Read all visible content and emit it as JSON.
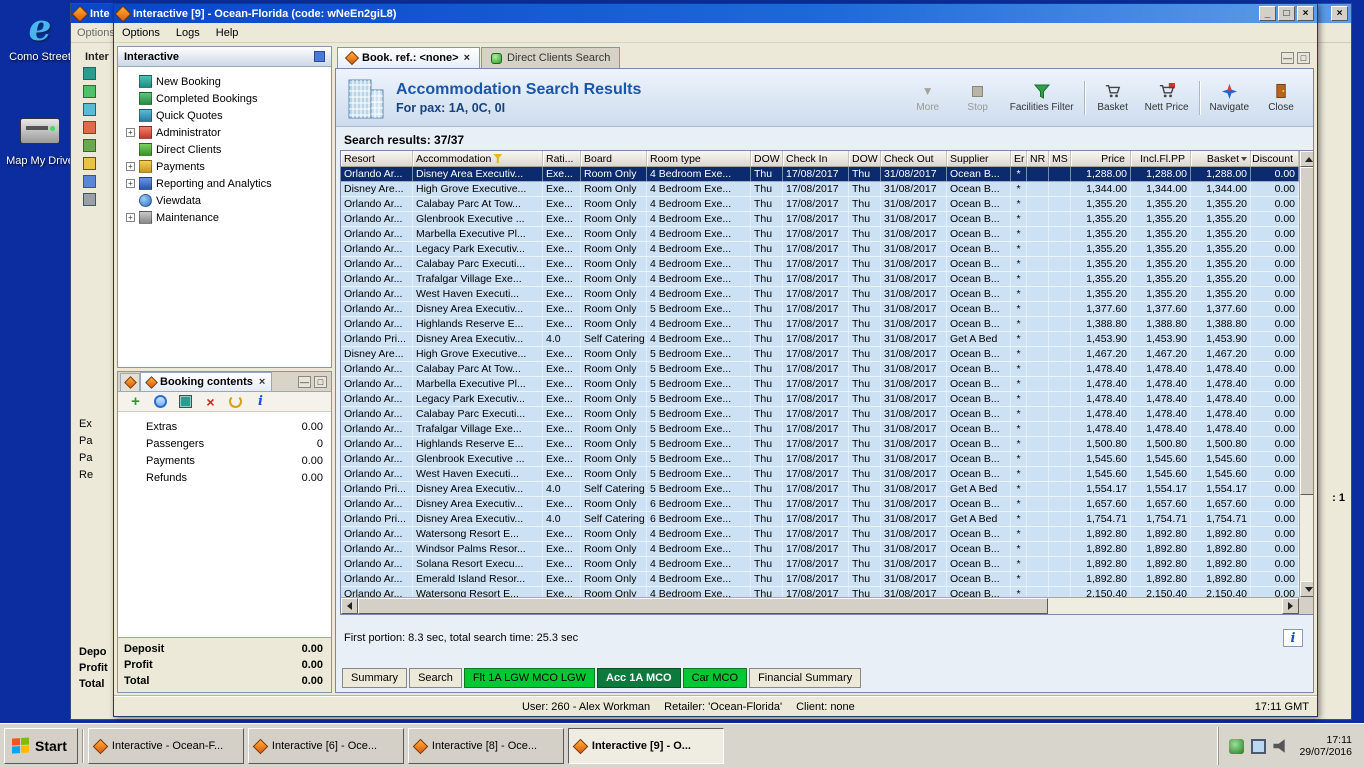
{
  "desktop": {
    "icons": [
      {
        "label": "Como Street"
      },
      {
        "label": "Map My Drive"
      }
    ]
  },
  "bg_window": {
    "title": "Inte",
    "menu": "Options",
    "panel_title": "Inter",
    "row_fragments": [
      "Ex",
      "Pa",
      "Pa",
      "Re"
    ],
    "total_fragments": [
      "Depo",
      "Profit",
      "Total"
    ],
    "right_fragment": ": 1"
  },
  "window": {
    "title": "Interactive [9] - Ocean-Florida (code: wNeEn2giL8)",
    "menu_items": [
      "Options",
      "Logs",
      "Help"
    ]
  },
  "nav_panel": {
    "title": "Interactive",
    "items": [
      {
        "label": "New Booking",
        "expand": "",
        "ic": "icon-booking"
      },
      {
        "label": "Completed Bookings",
        "expand": "",
        "ic": "icon-completed"
      },
      {
        "label": "Quick Quotes",
        "expand": "",
        "ic": "icon-quotes"
      },
      {
        "label": "Administrator",
        "expand": "+",
        "ic": "icon-admin"
      },
      {
        "label": "Direct Clients",
        "expand": "",
        "ic": "icon-clients"
      },
      {
        "label": "Payments",
        "expand": "+",
        "ic": "icon-payments"
      },
      {
        "label": "Reporting and Analytics",
        "expand": "+",
        "ic": "icon-reports"
      },
      {
        "label": "Viewdata",
        "expand": "",
        "ic": "icon-viewdata"
      },
      {
        "label": "Maintenance",
        "expand": "+",
        "ic": "icon-maintenance"
      }
    ]
  },
  "booking_panel": {
    "tab_title": "Booking contents",
    "close_glyph": "×",
    "rows": [
      {
        "label": "Extras",
        "value": "0.00"
      },
      {
        "label": "Passengers",
        "value": "0"
      },
      {
        "label": "Payments",
        "value": "0.00"
      },
      {
        "label": "Refunds",
        "value": "0.00"
      }
    ],
    "totals": [
      {
        "label": "Deposit",
        "value": "0.00"
      },
      {
        "label": "Profit",
        "value": "0.00"
      },
      {
        "label": "Total",
        "value": "0.00"
      }
    ]
  },
  "workspace": {
    "tabs": [
      {
        "label": "Book. ref.: <none>",
        "cls": "active",
        "icon": "orange",
        "close": "×"
      },
      {
        "label": "Direct Clients Search",
        "cls": "",
        "icon": "green",
        "close": ""
      }
    ],
    "header": {
      "title": "Accommodation Search Results",
      "subtitle": "For pax: 1A, 0C, 0I"
    },
    "toolbar": {
      "more": "More",
      "stop": "Stop",
      "facilities": "Facilities Filter",
      "basket": "Basket",
      "nett": "Nett Price",
      "navigate": "Navigate",
      "close": "Close"
    },
    "results_label": "Search results: 37/37",
    "timing": "First portion: 8.3 sec, total search time: 25.3 sec",
    "bottom_tabs": [
      {
        "label": "Summary",
        "cls": ""
      },
      {
        "label": "Search",
        "cls": ""
      },
      {
        "label": "Flt 1A LGW MCO LGW",
        "cls": "green"
      },
      {
        "label": "Acc 1A MCO",
        "cls": "darkgreen"
      },
      {
        "label": "Car MCO",
        "cls": "green"
      },
      {
        "label": "Financial Summary",
        "cls": ""
      }
    ],
    "status": {
      "parts": [
        "User: 260 - Alex Workman",
        "Retailer: 'Ocean-Florida'",
        "Client: none"
      ],
      "time": "17:11 GMT"
    }
  },
  "table": {
    "columns": [
      {
        "label": "Resort"
      },
      {
        "label": "Accommodation",
        "suffix": "filter"
      },
      {
        "label": "Rati..."
      },
      {
        "label": "Board"
      },
      {
        "label": "Room type"
      },
      {
        "label": "DOW"
      },
      {
        "label": "Check In"
      },
      {
        "label": "DOW"
      },
      {
        "label": "Check Out"
      },
      {
        "label": "Supplier"
      },
      {
        "label": "Er"
      },
      {
        "label": "NR"
      },
      {
        "label": "MS"
      },
      {
        "label": "Price",
        "cls": "num"
      },
      {
        "label": "Incl.Fl.PP",
        "cls": "num"
      },
      {
        "label": "Basket",
        "cls": "num",
        "suffix": "sort"
      },
      {
        "label": "Discount",
        "cls": "num"
      }
    ],
    "rows": [
      {
        "sel": "sel",
        "c": [
          "Orlando Ar...",
          "Disney Area Executiv...",
          "Exe...",
          "Room Only",
          "4 Bedroom Exe...",
          "Thu",
          "17/08/2017",
          "Thu",
          "31/08/2017",
          "Ocean B...",
          "*",
          "",
          "",
          "1,288.00",
          "1,288.00",
          "1,288.00",
          "0.00"
        ]
      },
      {
        "sel": "",
        "c": [
          "Disney Are...",
          "High Grove Executive...",
          "Exe...",
          "Room Only",
          "4 Bedroom Exe...",
          "Thu",
          "17/08/2017",
          "Thu",
          "31/08/2017",
          "Ocean B...",
          "*",
          "",
          "",
          "1,344.00",
          "1,344.00",
          "1,344.00",
          "0.00"
        ]
      },
      {
        "sel": "",
        "c": [
          "Orlando Ar...",
          "Calabay Parc At Tow...",
          "Exe...",
          "Room Only",
          "4 Bedroom Exe...",
          "Thu",
          "17/08/2017",
          "Thu",
          "31/08/2017",
          "Ocean B...",
          "*",
          "",
          "",
          "1,355.20",
          "1,355.20",
          "1,355.20",
          "0.00"
        ]
      },
      {
        "sel": "",
        "c": [
          "Orlando Ar...",
          "Glenbrook Executive ...",
          "Exe...",
          "Room Only",
          "4 Bedroom Exe...",
          "Thu",
          "17/08/2017",
          "Thu",
          "31/08/2017",
          "Ocean B...",
          "*",
          "",
          "",
          "1,355.20",
          "1,355.20",
          "1,355.20",
          "0.00"
        ]
      },
      {
        "sel": "",
        "c": [
          "Orlando Ar...",
          "Marbella Executive Pl...",
          "Exe...",
          "Room Only",
          "4 Bedroom Exe...",
          "Thu",
          "17/08/2017",
          "Thu",
          "31/08/2017",
          "Ocean B...",
          "*",
          "",
          "",
          "1,355.20",
          "1,355.20",
          "1,355.20",
          "0.00"
        ]
      },
      {
        "sel": "",
        "c": [
          "Orlando Ar...",
          "Legacy Park Executiv...",
          "Exe...",
          "Room Only",
          "4 Bedroom Exe...",
          "Thu",
          "17/08/2017",
          "Thu",
          "31/08/2017",
          "Ocean B...",
          "*",
          "",
          "",
          "1,355.20",
          "1,355.20",
          "1,355.20",
          "0.00"
        ]
      },
      {
        "sel": "",
        "c": [
          "Orlando Ar...",
          "Calabay Parc Executi...",
          "Exe...",
          "Room Only",
          "4 Bedroom Exe...",
          "Thu",
          "17/08/2017",
          "Thu",
          "31/08/2017",
          "Ocean B...",
          "*",
          "",
          "",
          "1,355.20",
          "1,355.20",
          "1,355.20",
          "0.00"
        ]
      },
      {
        "sel": "",
        "c": [
          "Orlando Ar...",
          "Trafalgar Village Exe...",
          "Exe...",
          "Room Only",
          "4 Bedroom Exe...",
          "Thu",
          "17/08/2017",
          "Thu",
          "31/08/2017",
          "Ocean B...",
          "*",
          "",
          "",
          "1,355.20",
          "1,355.20",
          "1,355.20",
          "0.00"
        ]
      },
      {
        "sel": "",
        "c": [
          "Orlando Ar...",
          "West Haven Executi...",
          "Exe...",
          "Room Only",
          "4 Bedroom Exe...",
          "Thu",
          "17/08/2017",
          "Thu",
          "31/08/2017",
          "Ocean B...",
          "*",
          "",
          "",
          "1,355.20",
          "1,355.20",
          "1,355.20",
          "0.00"
        ]
      },
      {
        "sel": "",
        "c": [
          "Orlando Ar...",
          "Disney Area Executiv...",
          "Exe...",
          "Room Only",
          "5 Bedroom Exe...",
          "Thu",
          "17/08/2017",
          "Thu",
          "31/08/2017",
          "Ocean B...",
          "*",
          "",
          "",
          "1,377.60",
          "1,377.60",
          "1,377.60",
          "0.00"
        ]
      },
      {
        "sel": "",
        "c": [
          "Orlando Ar...",
          "Highlands Reserve E...",
          "Exe...",
          "Room Only",
          "4 Bedroom Exe...",
          "Thu",
          "17/08/2017",
          "Thu",
          "31/08/2017",
          "Ocean B...",
          "*",
          "",
          "",
          "1,388.80",
          "1,388.80",
          "1,388.80",
          "0.00"
        ]
      },
      {
        "sel": "",
        "c": [
          "Orlando Pri...",
          "Disney Area Executiv...",
          "4.0",
          "Self Catering",
          "4 Bedroom Exe...",
          "Thu",
          "17/08/2017",
          "Thu",
          "31/08/2017",
          "Get A Bed",
          "*",
          "",
          "",
          "1,453.90",
          "1,453.90",
          "1,453.90",
          "0.00"
        ]
      },
      {
        "sel": "",
        "c": [
          "Disney Are...",
          "High Grove Executive...",
          "Exe...",
          "Room Only",
          "5 Bedroom Exe...",
          "Thu",
          "17/08/2017",
          "Thu",
          "31/08/2017",
          "Ocean B...",
          "*",
          "",
          "",
          "1,467.20",
          "1,467.20",
          "1,467.20",
          "0.00"
        ]
      },
      {
        "sel": "",
        "c": [
          "Orlando Ar...",
          "Calabay Parc At Tow...",
          "Exe...",
          "Room Only",
          "5 Bedroom Exe...",
          "Thu",
          "17/08/2017",
          "Thu",
          "31/08/2017",
          "Ocean B...",
          "*",
          "",
          "",
          "1,478.40",
          "1,478.40",
          "1,478.40",
          "0.00"
        ]
      },
      {
        "sel": "",
        "c": [
          "Orlando Ar...",
          "Marbella Executive Pl...",
          "Exe...",
          "Room Only",
          "5 Bedroom Exe...",
          "Thu",
          "17/08/2017",
          "Thu",
          "31/08/2017",
          "Ocean B...",
          "*",
          "",
          "",
          "1,478.40",
          "1,478.40",
          "1,478.40",
          "0.00"
        ]
      },
      {
        "sel": "",
        "c": [
          "Orlando Ar...",
          "Legacy Park Executiv...",
          "Exe...",
          "Room Only",
          "5 Bedroom Exe...",
          "Thu",
          "17/08/2017",
          "Thu",
          "31/08/2017",
          "Ocean B...",
          "*",
          "",
          "",
          "1,478.40",
          "1,478.40",
          "1,478.40",
          "0.00"
        ]
      },
      {
        "sel": "",
        "c": [
          "Orlando Ar...",
          "Calabay Parc Executi...",
          "Exe...",
          "Room Only",
          "5 Bedroom Exe...",
          "Thu",
          "17/08/2017",
          "Thu",
          "31/08/2017",
          "Ocean B...",
          "*",
          "",
          "",
          "1,478.40",
          "1,478.40",
          "1,478.40",
          "0.00"
        ]
      },
      {
        "sel": "",
        "c": [
          "Orlando Ar...",
          "Trafalgar Village Exe...",
          "Exe...",
          "Room Only",
          "5 Bedroom Exe...",
          "Thu",
          "17/08/2017",
          "Thu",
          "31/08/2017",
          "Ocean B...",
          "*",
          "",
          "",
          "1,478.40",
          "1,478.40",
          "1,478.40",
          "0.00"
        ]
      },
      {
        "sel": "",
        "c": [
          "Orlando Ar...",
          "Highlands Reserve E...",
          "Exe...",
          "Room Only",
          "5 Bedroom Exe...",
          "Thu",
          "17/08/2017",
          "Thu",
          "31/08/2017",
          "Ocean B...",
          "*",
          "",
          "",
          "1,500.80",
          "1,500.80",
          "1,500.80",
          "0.00"
        ]
      },
      {
        "sel": "",
        "c": [
          "Orlando Ar...",
          "Glenbrook Executive ...",
          "Exe...",
          "Room Only",
          "5 Bedroom Exe...",
          "Thu",
          "17/08/2017",
          "Thu",
          "31/08/2017",
          "Ocean B...",
          "*",
          "",
          "",
          "1,545.60",
          "1,545.60",
          "1,545.60",
          "0.00"
        ]
      },
      {
        "sel": "",
        "c": [
          "Orlando Ar...",
          "West Haven Executi...",
          "Exe...",
          "Room Only",
          "5 Bedroom Exe...",
          "Thu",
          "17/08/2017",
          "Thu",
          "31/08/2017",
          "Ocean B...",
          "*",
          "",
          "",
          "1,545.60",
          "1,545.60",
          "1,545.60",
          "0.00"
        ]
      },
      {
        "sel": "",
        "c": [
          "Orlando Pri...",
          "Disney Area Executiv...",
          "4.0",
          "Self Catering",
          "5 Bedroom Exe...",
          "Thu",
          "17/08/2017",
          "Thu",
          "31/08/2017",
          "Get A Bed",
          "*",
          "",
          "",
          "1,554.17",
          "1,554.17",
          "1,554.17",
          "0.00"
        ]
      },
      {
        "sel": "",
        "c": [
          "Orlando Ar...",
          "Disney Area Executiv...",
          "Exe...",
          "Room Only",
          "6 Bedroom Exe...",
          "Thu",
          "17/08/2017",
          "Thu",
          "31/08/2017",
          "Ocean B...",
          "*",
          "",
          "",
          "1,657.60",
          "1,657.60",
          "1,657.60",
          "0.00"
        ]
      },
      {
        "sel": "",
        "c": [
          "Orlando Pri...",
          "Disney Area Executiv...",
          "4.0",
          "Self Catering",
          "6 Bedroom Exe...",
          "Thu",
          "17/08/2017",
          "Thu",
          "31/08/2017",
          "Get A Bed",
          "*",
          "",
          "",
          "1,754.71",
          "1,754.71",
          "1,754.71",
          "0.00"
        ]
      },
      {
        "sel": "",
        "c": [
          "Orlando Ar...",
          "Watersong Resort E...",
          "Exe...",
          "Room Only",
          "4 Bedroom Exe...",
          "Thu",
          "17/08/2017",
          "Thu",
          "31/08/2017",
          "Ocean B...",
          "*",
          "",
          "",
          "1,892.80",
          "1,892.80",
          "1,892.80",
          "0.00"
        ]
      },
      {
        "sel": "",
        "c": [
          "Orlando Ar...",
          "Windsor Palms Resor...",
          "Exe...",
          "Room Only",
          "4 Bedroom Exe...",
          "Thu",
          "17/08/2017",
          "Thu",
          "31/08/2017",
          "Ocean B...",
          "*",
          "",
          "",
          "1,892.80",
          "1,892.80",
          "1,892.80",
          "0.00"
        ]
      },
      {
        "sel": "",
        "c": [
          "Orlando Ar...",
          "Solana Resort Execu...",
          "Exe...",
          "Room Only",
          "4 Bedroom Exe...",
          "Thu",
          "17/08/2017",
          "Thu",
          "31/08/2017",
          "Ocean B...",
          "*",
          "",
          "",
          "1,892.80",
          "1,892.80",
          "1,892.80",
          "0.00"
        ]
      },
      {
        "sel": "",
        "c": [
          "Orlando Ar...",
          "Emerald Island Resor...",
          "Exe...",
          "Room Only",
          "4 Bedroom Exe...",
          "Thu",
          "17/08/2017",
          "Thu",
          "31/08/2017",
          "Ocean B...",
          "*",
          "",
          "",
          "1,892.80",
          "1,892.80",
          "1,892.80",
          "0.00"
        ]
      },
      {
        "sel": "",
        "c": [
          "Orlando Ar...",
          "Watersong Resort E...",
          "Exe...",
          "Room Only",
          "4 Bedroom Exe...",
          "Thu",
          "17/08/2017",
          "Thu",
          "31/08/2017",
          "Ocean B...",
          "*",
          "",
          "",
          "2,150.40",
          "2,150.40",
          "2,150.40",
          "0.00"
        ]
      }
    ]
  },
  "taskbar": {
    "start": "Start",
    "buttons": [
      {
        "label": "Interactive - Ocean-F...",
        "cls": ""
      },
      {
        "label": "Interactive [6] - Oce...",
        "cls": ""
      },
      {
        "label": "Interactive [8] - Oce...",
        "cls": ""
      },
      {
        "label": "Interactive [9] - O...",
        "cls": "active"
      }
    ],
    "clock": {
      "time": "17:11",
      "date": "29/07/2016"
    }
  }
}
